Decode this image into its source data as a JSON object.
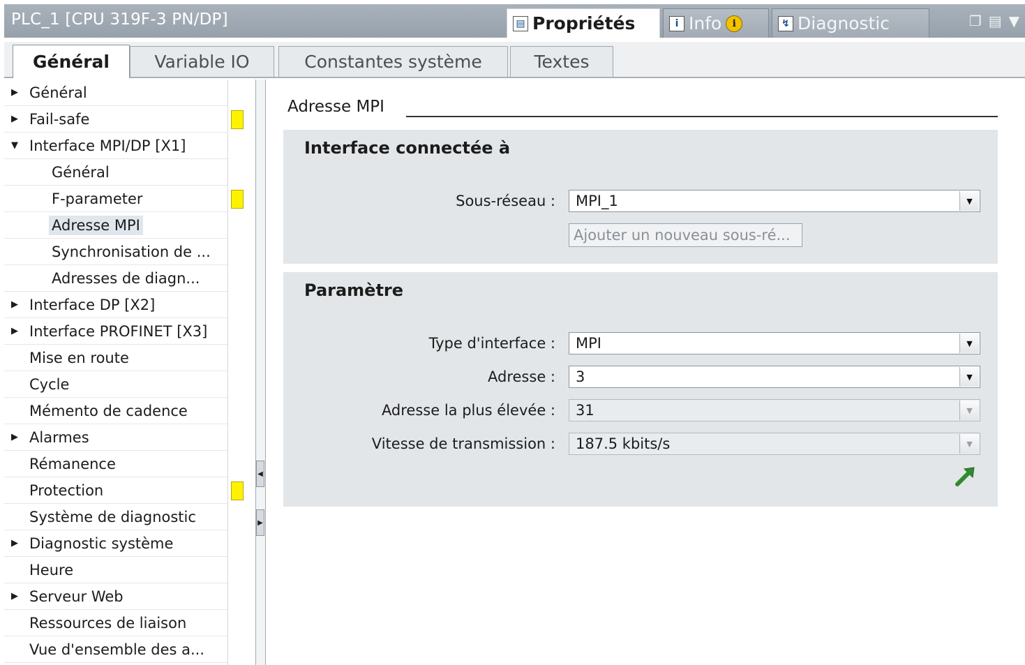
{
  "window": {
    "title": "PLC_1 [CPU 319F-3 PN/DP]",
    "tabs": [
      {
        "label": "Propriétés",
        "icon": "properties-icon",
        "active": true
      },
      {
        "label": "Info",
        "icon": "info-icon",
        "active": false
      },
      {
        "label": "Diagnostic",
        "icon": "diagnostic-icon",
        "active": false
      }
    ],
    "info_badge": "i"
  },
  "subtabs": [
    "Général",
    "Variable IO",
    "Constantes système",
    "Textes"
  ],
  "tree": [
    {
      "label": "Général",
      "level": 0,
      "expander": "collapsed"
    },
    {
      "label": "Fail-safe",
      "level": 0,
      "expander": "collapsed",
      "marker": true
    },
    {
      "label": "Interface MPI/DP [X1]",
      "level": 0,
      "expander": "expanded"
    },
    {
      "label": "Général",
      "level": 1
    },
    {
      "label": "F-parameter",
      "level": 1,
      "marker": true
    },
    {
      "label": "Adresse MPI",
      "level": 1,
      "selected": true
    },
    {
      "label": "Synchronisation de ...",
      "level": 1
    },
    {
      "label": "Adresses de diagn...",
      "level": 1
    },
    {
      "label": "Interface DP [X2]",
      "level": 0,
      "expander": "collapsed"
    },
    {
      "label": "Interface PROFINET [X3]",
      "level": 0,
      "expander": "collapsed"
    },
    {
      "label": "Mise en route",
      "level": 0
    },
    {
      "label": "Cycle",
      "level": 0
    },
    {
      "label": "Mémento de cadence",
      "level": 0
    },
    {
      "label": "Alarmes",
      "level": 0,
      "expander": "collapsed"
    },
    {
      "label": "Rémanence",
      "level": 0
    },
    {
      "label": "Protection",
      "level": 0,
      "marker": true
    },
    {
      "label": "Système de diagnostic",
      "level": 0
    },
    {
      "label": "Diagnostic système",
      "level": 0,
      "expander": "collapsed"
    },
    {
      "label": "Heure",
      "level": 0
    },
    {
      "label": "Serveur Web",
      "level": 0,
      "expander": "collapsed"
    },
    {
      "label": "Ressources de liaison",
      "level": 0
    },
    {
      "label": "Vue d'ensemble des a...",
      "level": 0
    }
  ],
  "content": {
    "section_title": "Adresse MPI",
    "interface_group": {
      "title": "Interface connectée à",
      "subnet_label": "Sous-réseau :",
      "subnet_value": "MPI_1",
      "add_subnet_button": "Ajouter un nouveau sous-ré..."
    },
    "param_group": {
      "title": "Paramètre",
      "fields": [
        {
          "label": "Type d'interface :",
          "value": "MPI",
          "enabled": true
        },
        {
          "label": "Adresse :",
          "value": "3",
          "enabled": true
        },
        {
          "label": "Adresse la plus élevée :",
          "value": "31",
          "enabled": false
        },
        {
          "label": "Vitesse de transmission :",
          "value": "187.5 kbits/s",
          "enabled": false
        }
      ]
    }
  },
  "colors": {
    "marker_yellow": "#fff200",
    "group_bg": "#e3e6e9",
    "goto_arrow": "#2e8b2e"
  }
}
